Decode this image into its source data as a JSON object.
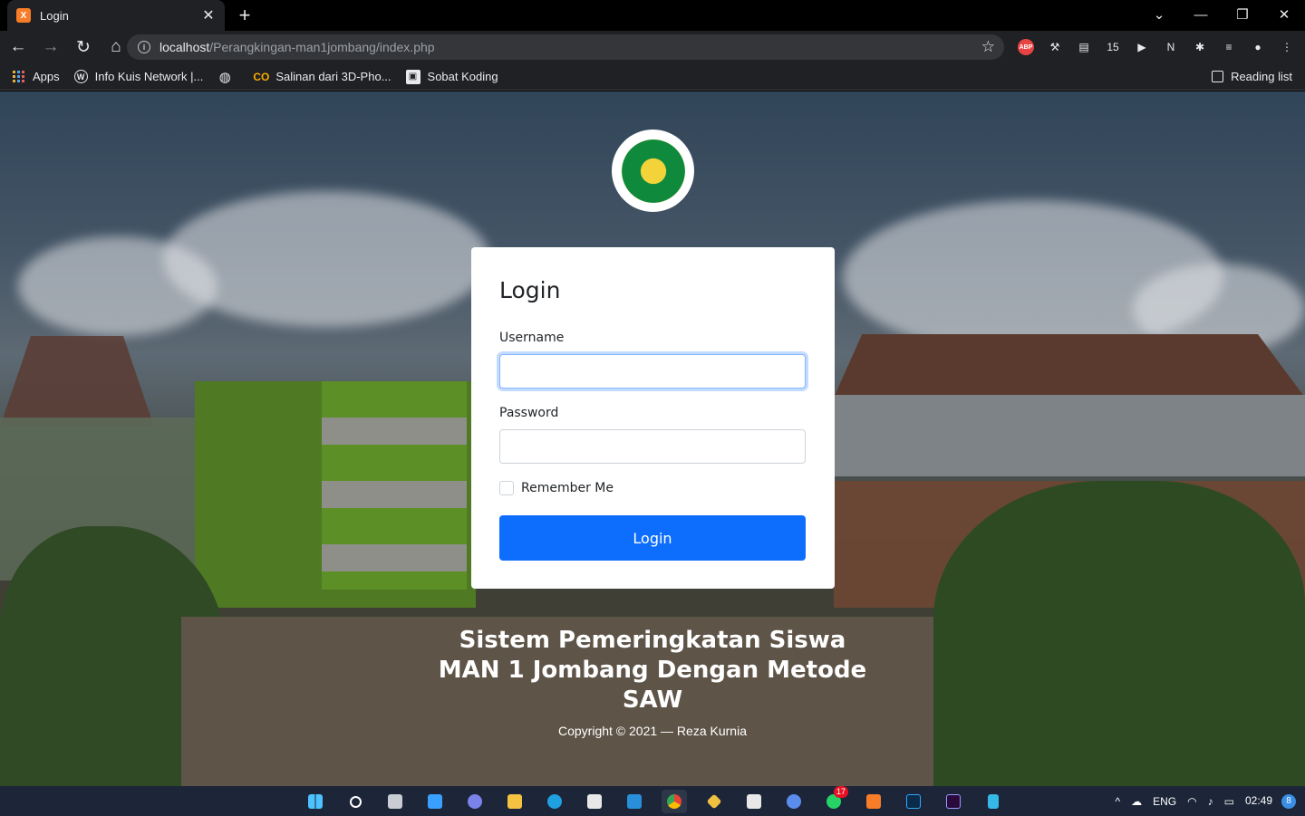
{
  "browser": {
    "tab_title": "Login",
    "tab_favicon": "X",
    "close_tab": "✕",
    "new_tab": "+",
    "url_host": "localhost",
    "url_path": "/Perangkingan-man1jombang/index.php",
    "bookmarks": [
      {
        "label": "Apps",
        "icon": "apps-grid-icon"
      },
      {
        "label": "Info Kuis Network |...",
        "icon": "wordpress-icon"
      },
      {
        "label": "",
        "icon": "globe-icon"
      },
      {
        "label": "Salinan dari 3D-Pho...",
        "icon": "colab-icon"
      },
      {
        "label": "Sobat Koding",
        "icon": "sobat-koding-icon"
      }
    ],
    "reading_list": "Reading list",
    "extensions": [
      {
        "name": "adblock-plus-icon",
        "text": "ABP"
      },
      {
        "name": "extension-hammer-icon",
        "text": "⚒"
      },
      {
        "name": "extension-note-icon",
        "text": "▤"
      },
      {
        "name": "extension-calendar-icon",
        "text": "15"
      },
      {
        "name": "extension-play-icon",
        "text": "▶"
      },
      {
        "name": "extension-n-icon",
        "text": "N"
      },
      {
        "name": "extensions-puzzle-icon",
        "text": "✱"
      },
      {
        "name": "media-queue-icon",
        "text": "≡"
      },
      {
        "name": "profile-avatar-icon",
        "text": "●"
      },
      {
        "name": "menu-kebab-icon",
        "text": "⋮"
      }
    ]
  },
  "login": {
    "title": "Login",
    "username_label": "Username",
    "username_value": "",
    "password_label": "Password",
    "password_value": "",
    "remember_label": "Remember Me",
    "submit_label": "Login"
  },
  "footer": {
    "title": "Sistem Pemeringkatan Siswa MAN 1 Jombang Dengan Metode SAW",
    "copyright": "Copyright © 2021 — Reza Kurnia"
  },
  "taskbar": {
    "language": "ENG",
    "time": "02:49",
    "notifications": "8",
    "whatsapp_badge": "17"
  },
  "colors": {
    "primary": "#0d6efd",
    "chrome_bg": "#202124",
    "taskbar_bg": "#1c2638"
  }
}
